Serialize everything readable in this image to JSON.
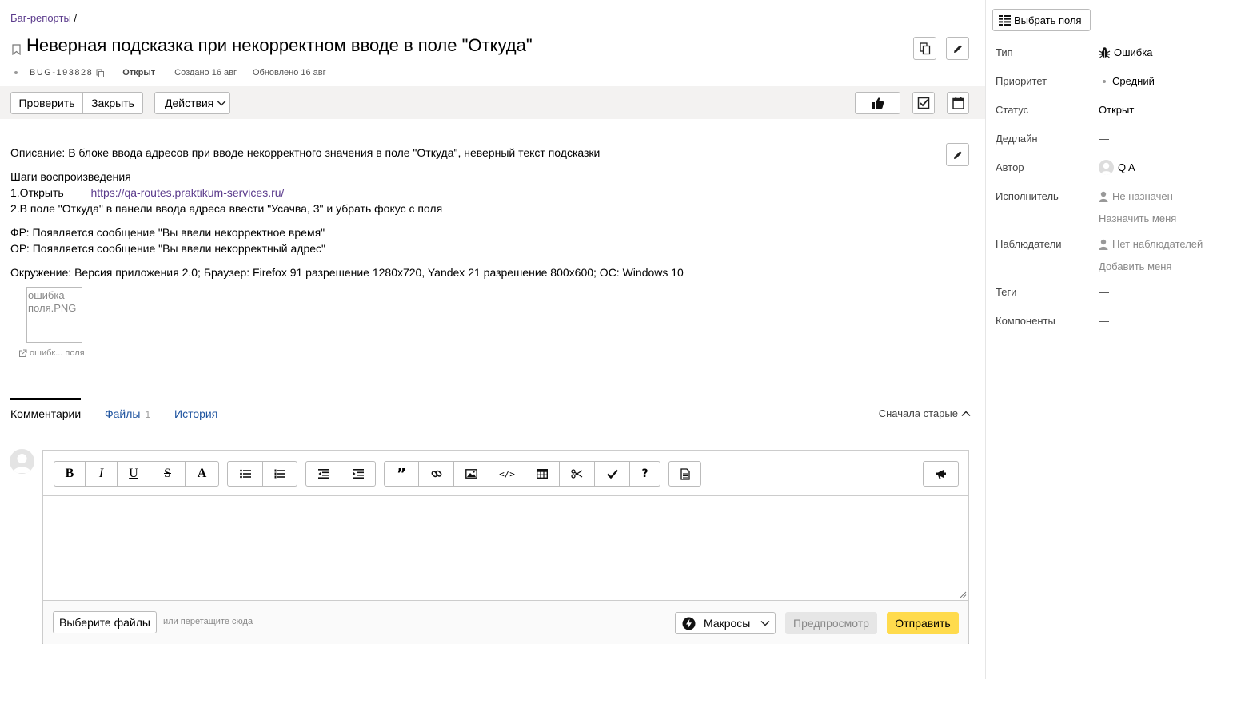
{
  "breadcrumb": {
    "link": "Баг-репорты",
    "sep": "/"
  },
  "issue": {
    "title": "Неверная подсказка при некорректном вводе в поле \"Откуда\"",
    "key": "BUG-193828",
    "status": "Открыт",
    "created": "Создано 16 авг",
    "updated": "Обновлено 16 авг"
  },
  "toolbar": {
    "verify": "Проверить",
    "close": "Закрыть",
    "actions": "Действия"
  },
  "description": {
    "line1": "Описание: В блоке ввода адресов при вводе некорректного значения в поле \"Откуда\", неверный текст подсказки",
    "steps_title": "Шаги воспроизведения",
    "step1_prefix": "1.Открыть",
    "step1_link": "https://qa-routes.praktikum-services.ru/",
    "step2": "2.В поле \"Откуда\" в панели ввода адреса ввести \"Усачва, 3\" и убрать фокус с поля",
    "fr": "ФР: Появляется сообщение \"Вы ввели некорректное время\"",
    "or": "ОР: Появляется сообщение \"Вы ввели некорректный адрес\"",
    "env": "Окружение: Версия приложения 2.0; Браузер: Firefox 91 разрешение 1280x720, Yandex 21 разрешение 800x600; ОС: Windows 10",
    "attachment_alt": "ошибка поля.PNG",
    "attachment_caption": "ошибк... поля"
  },
  "tabs": {
    "comments": "Комментарии",
    "files": "Файлы",
    "files_count": "1",
    "history": "История",
    "sort": "Сначала старые"
  },
  "editor": {
    "bold": "B",
    "italic": "I",
    "underline": "U",
    "strike": "S",
    "font": "A",
    "help": "?",
    "choose_files": "Выберите файлы",
    "drag_hint": "или перетащите сюда",
    "macros": "Макросы",
    "preview": "Предпросмотр",
    "send": "Отправить"
  },
  "sidebar": {
    "choose_fields": "Выбрать поля",
    "type_label": "Тип",
    "type_value": "Ошибка",
    "priority_label": "Приоритет",
    "priority_value": "Средний",
    "status_label": "Статус",
    "status_value": "Открыт",
    "deadline_label": "Дедлайн",
    "deadline_value": "—",
    "author_label": "Автор",
    "author_value": "Q A",
    "assignee_label": "Исполнитель",
    "assignee_value": "Не назначен",
    "assign_me": "Назначить меня",
    "watchers_label": "Наблюдатели",
    "watchers_value": "Нет наблюдателей",
    "add_me": "Добавить меня",
    "tags_label": "Теги",
    "tags_value": "—",
    "components_label": "Компоненты",
    "components_value": "—"
  },
  "colors": {
    "accent_link": "#5b3b8c",
    "tab_link": "#2055a0",
    "send_button": "#ffdb4d",
    "toolbar_bg": "#f3f2f1"
  }
}
